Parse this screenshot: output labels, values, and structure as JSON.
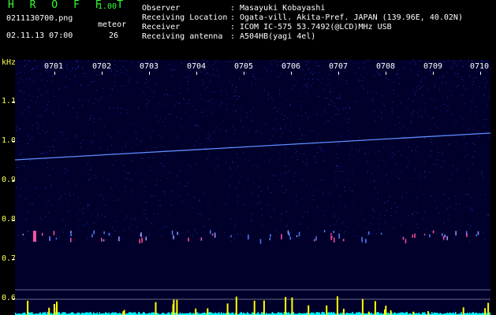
{
  "header": {
    "app_title": "H R O F F T",
    "app_version": "1.00",
    "filename": "0211130700.png",
    "datetime": "02.11.13 07:00",
    "meteor_label": "meteor",
    "meteor_count": "26"
  },
  "info": [
    {
      "key": "Observer",
      "value": "Masayuki Kobayashi"
    },
    {
      "key": "Receiving Location",
      "value": "Ogata-vill. Akita-Pref. JAPAN (139.96E, 40.02N)"
    },
    {
      "key": "Receiver",
      "value": "ICOM IC-575 53.7492(@LCD)MHz USB"
    },
    {
      "key": "Receiving antenna",
      "value": "A504HB(yagi 4el)"
    }
  ],
  "info_separator": ":",
  "axis": {
    "y_unit": "kHz",
    "y_ticks": [
      "1.1",
      "1.0",
      "0.9",
      "0.8",
      "0.7",
      "0.6"
    ],
    "x_ticks": [
      "0701",
      "0702",
      "0703",
      "0704",
      "0705",
      "0706",
      "0707",
      "0708",
      "0709",
      "0710"
    ]
  },
  "colors": {
    "background": "#000000",
    "plot_background": "#00002a",
    "noise": "#3b3bff",
    "header_green": "#33ff33",
    "tick_yellow": "#ffff55",
    "carrier_line": "#5f8cff",
    "meteor_pink": "#ff4fa0",
    "histogram_yellow": "#ffff00",
    "histogram_cyan": "#00ffff"
  }
}
